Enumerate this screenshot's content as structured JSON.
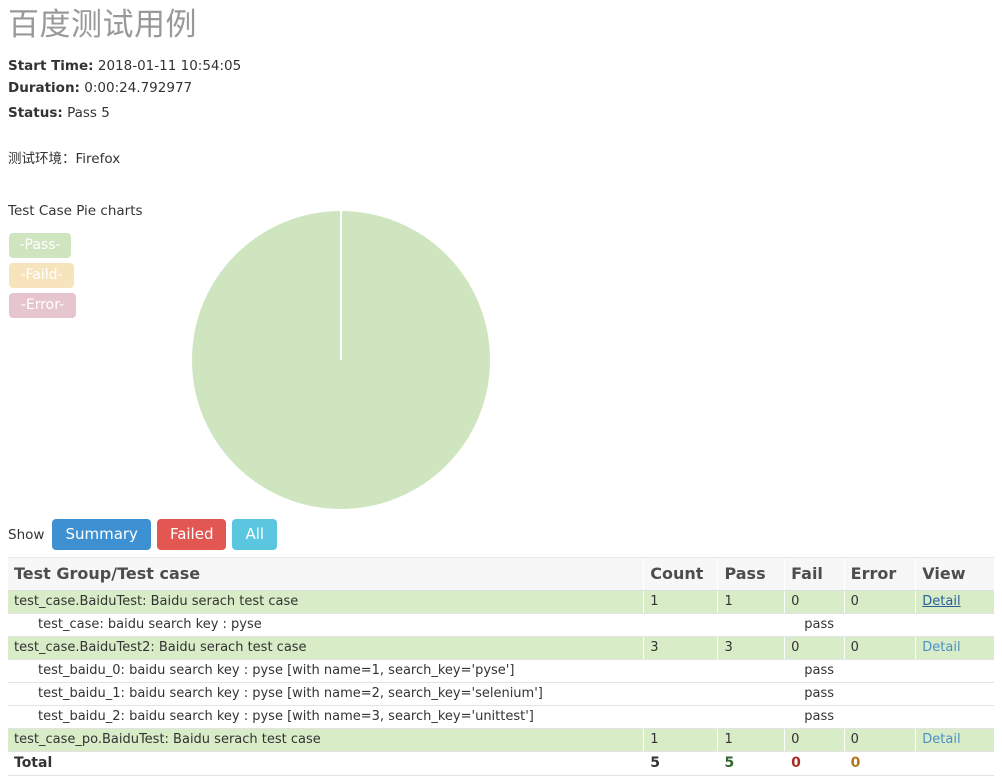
{
  "report": {
    "title": "百度测试用例",
    "start_time_label": "Start Time:",
    "start_time_value": "2018-01-11 10:54:05",
    "duration_label": "Duration:",
    "duration_value": "0:00:24.792977",
    "status_label": "Status:",
    "status_value": "Pass 5",
    "environment_line": "测试环境：Firefox"
  },
  "pie": {
    "section_title": "Test Case Pie charts",
    "legend": [
      {
        "label": "-Pass-",
        "color": "#cfe5c0"
      },
      {
        "label": "-Faild-",
        "color": "#f7e4bd"
      },
      {
        "label": "-Error-",
        "color": "#e6c5cf"
      }
    ]
  },
  "chart_data": {
    "type": "pie",
    "title": "Test Case Pie charts",
    "labels": [
      "Pass",
      "Faild",
      "Error"
    ],
    "values": [
      5,
      0,
      0
    ],
    "percentages": [
      100,
      0,
      0
    ],
    "colors": [
      "#cfe5c0",
      "#f7e4bd",
      "#e6c5cf"
    ],
    "legend_position": "left",
    "start_angle": 90,
    "slice_border_color": "#ffffff"
  },
  "filters": {
    "label": "Show",
    "buttons": [
      {
        "label": "Summary",
        "color": "#3d90d1"
      },
      {
        "label": "Failed",
        "color": "#e25751"
      },
      {
        "label": "All",
        "color": "#5bc6df"
      }
    ]
  },
  "table": {
    "headers": {
      "name": "Test Group/Test case",
      "count": "Count",
      "pass": "Pass",
      "fail": "Fail",
      "error": "Error",
      "view": "View"
    },
    "rows": [
      {
        "type": "group",
        "name": "test_case.BaiduTest: Baidu serach test case",
        "count": "1",
        "pass": "1",
        "fail": "0",
        "error": "0",
        "view": "Detail"
      },
      {
        "type": "case",
        "name": "test_case: baidu search key : pyse",
        "status": "pass"
      },
      {
        "type": "group",
        "name": "test_case.BaiduTest2: Baidu serach test case",
        "count": "3",
        "pass": "3",
        "fail": "0",
        "error": "0",
        "view": "Detail"
      },
      {
        "type": "case",
        "name": "test_baidu_0: baidu search key : pyse [with name=1, search_key='pyse']",
        "status": "pass"
      },
      {
        "type": "case",
        "name": "test_baidu_1: baidu search key : pyse [with name=2, search_key='selenium']",
        "status": "pass"
      },
      {
        "type": "case",
        "name": "test_baidu_2: baidu search key : pyse [with name=3, search_key='unittest']",
        "status": "pass"
      },
      {
        "type": "group",
        "name": "test_case_po.BaiduTest: Baidu serach test case",
        "count": "1",
        "pass": "1",
        "fail": "0",
        "error": "0",
        "view": "Detail"
      }
    ],
    "total": {
      "label": "Total",
      "count": "5",
      "pass": "5",
      "fail": "0",
      "error": "0"
    }
  }
}
